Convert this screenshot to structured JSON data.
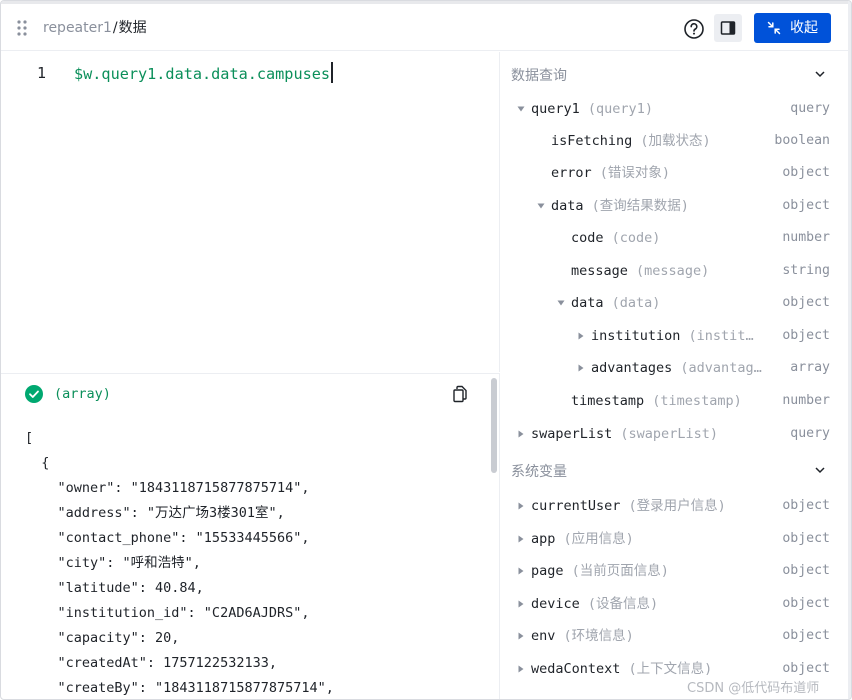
{
  "header": {
    "breadcrumb_parent": "repeater1",
    "breadcrumb_sep": "/",
    "breadcrumb_current": "数据",
    "collapse_label": "收起"
  },
  "editor": {
    "line_number": "1",
    "expression": "$w.query1.data.data.campuses"
  },
  "result": {
    "type_label": "(array)",
    "json_lines": [
      "[",
      "  {",
      "    \"owner\": \"1843118715877875714\",",
      "    \"address\": \"万达广场3楼301室\",",
      "    \"contact_phone\": \"15533445566\",",
      "    \"city\": \"呼和浩特\",",
      "    \"latitude\": 40.84,",
      "    \"institution_id\": \"C2AD6AJDRS\",",
      "    \"capacity\": 20,",
      "    \"createdAt\": 1757122532133,",
      "    \"createBy\": \"1843118715877875714\","
    ]
  },
  "sections": {
    "data_query": "数据查询",
    "system_vars": "系统变量"
  },
  "tree": {
    "query1": {
      "name": "query1",
      "alias": "(query1)",
      "type": "query"
    },
    "isFetching": {
      "name": "isFetching",
      "alias": "(加载状态)",
      "type": "boolean"
    },
    "error": {
      "name": "error",
      "alias": "(错误对象)",
      "type": "object"
    },
    "data": {
      "name": "data",
      "alias": "(查询结果数据)",
      "type": "object"
    },
    "code": {
      "name": "code",
      "alias": "(code)",
      "type": "number"
    },
    "message": {
      "name": "message",
      "alias": "(message)",
      "type": "string"
    },
    "data2": {
      "name": "data",
      "alias": "(data)",
      "type": "object"
    },
    "institution": {
      "name": "institution",
      "alias": "(instit…",
      "type": "object"
    },
    "advantages": {
      "name": "advantages",
      "alias": "(advantag…",
      "type": "array"
    },
    "timestamp": {
      "name": "timestamp",
      "alias": "(timestamp)",
      "type": "number"
    },
    "swaperList": {
      "name": "swaperList",
      "alias": "(swaperList)",
      "type": "query"
    },
    "currentUser": {
      "name": "currentUser",
      "alias": "(登录用户信息)",
      "type": "object"
    },
    "app": {
      "name": "app",
      "alias": "(应用信息)",
      "type": "object"
    },
    "page": {
      "name": "page",
      "alias": "(当前页面信息)",
      "type": "object"
    },
    "device": {
      "name": "device",
      "alias": "(设备信息)",
      "type": "object"
    },
    "env": {
      "name": "env",
      "alias": "(环境信息)",
      "type": "object"
    },
    "wedaContext": {
      "name": "wedaContext",
      "alias": "(上下文信息)",
      "type": "object"
    }
  },
  "watermark": "CSDN @低代码布道师",
  "colors": {
    "primary": "#0052d9",
    "code_green": "#0b8f5a",
    "success": "#00a870",
    "muted": "#8a909c"
  }
}
